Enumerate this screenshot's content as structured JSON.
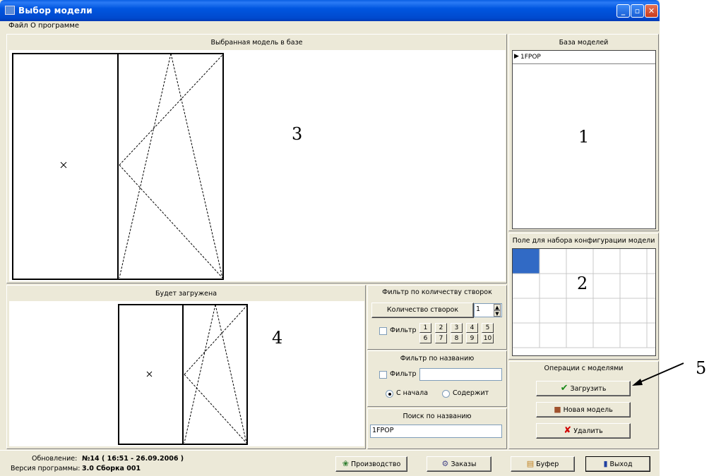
{
  "window": {
    "title": "Выбор модели"
  },
  "menu": [
    {
      "label": "Файл"
    },
    {
      "label": "О программе"
    }
  ],
  "panels": {
    "selected_model": "Выбранная модель в базе",
    "to_load": "Будет загружена",
    "model_base": "База моделей",
    "config_field": "Поле для набора конфигурации модели",
    "operations": "Операции с моделями"
  },
  "model_base": {
    "items": [
      "1FPOP"
    ]
  },
  "filter_count": {
    "title": "Фильтр по количеству створок",
    "button": "Количество створок",
    "value": "1",
    "checkbox_label": "Фильтр",
    "numbers": [
      "1",
      "2",
      "3",
      "4",
      "5",
      "6",
      "7",
      "8",
      "9",
      "10"
    ]
  },
  "filter_name": {
    "title": "Фильтр по названию",
    "checkbox_label": "Фильтр",
    "value": "",
    "radio_start": "С начала",
    "radio_contains": "Содержит"
  },
  "search": {
    "title": "Поиск по названию",
    "value": "1FPOP"
  },
  "operations": {
    "load": "Загрузить",
    "new": "Новая модель",
    "delete": "Удалить"
  },
  "status": {
    "update_label": "Обновление:",
    "update_value": "№14 ( 16:51 - 26.09.2006 )",
    "version_label": "Версия программы:",
    "version_value": "3.0 Сборка 001"
  },
  "bottom_buttons": {
    "production": "Производство",
    "orders": "Заказы",
    "buffer": "Буфер",
    "exit": "Выход"
  },
  "annotations": [
    "1",
    "2",
    "3",
    "4",
    "5"
  ],
  "colors": {
    "selected_cell": "#316AC5",
    "titlebar": "#0054E3",
    "delete_icon": "#D00000",
    "load_icon": "#1A8A1A"
  }
}
